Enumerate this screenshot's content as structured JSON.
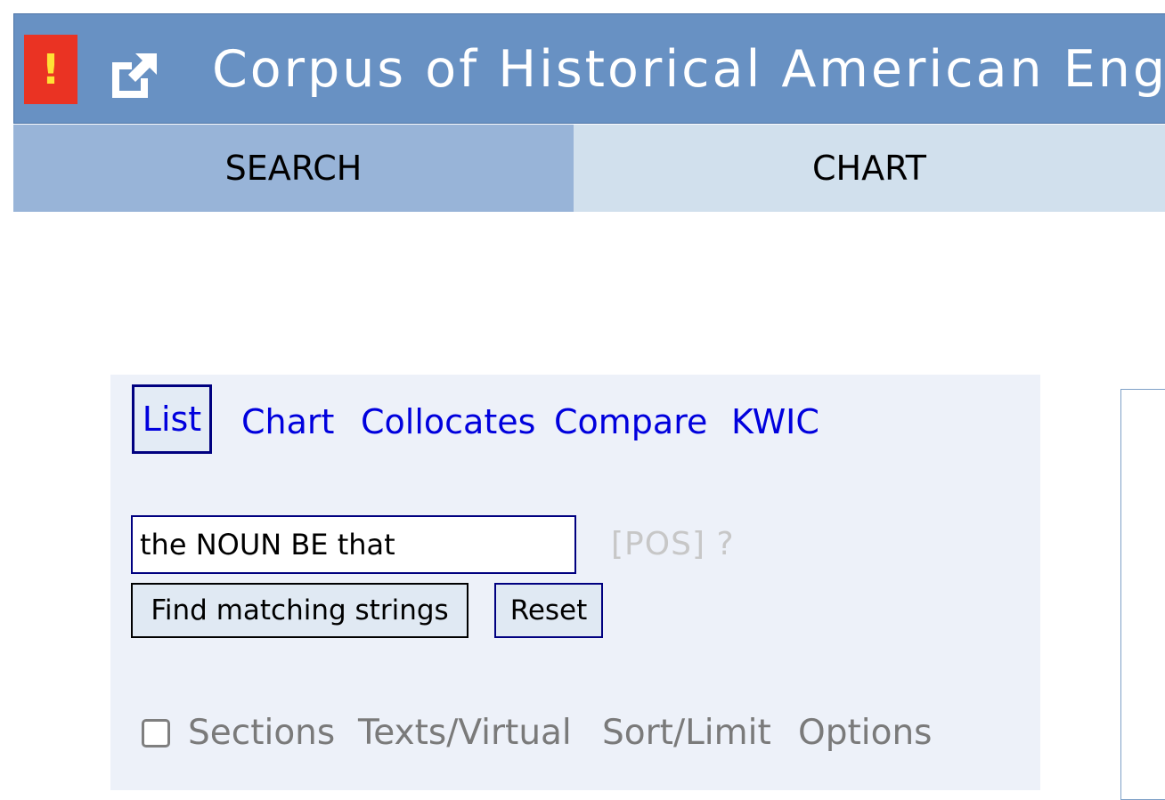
{
  "header": {
    "alert_symbol": "!",
    "alert_color": "#ea3323",
    "title": "Corpus of Historical American English",
    "background_color": "#6891c3",
    "external_link_icon": "external-link-icon"
  },
  "tabs": [
    {
      "label": "SEARCH",
      "active": true
    },
    {
      "label": "CHART",
      "active": false
    }
  ],
  "modes": [
    "List",
    "Chart",
    "Collocates",
    "Compare",
    "KWIC"
  ],
  "active_mode": "List",
  "search": {
    "value": "the NOUN BE that",
    "pos_label": "[POS]",
    "help_label": "?"
  },
  "buttons": {
    "find": "Find matching strings",
    "reset": "Reset"
  },
  "options": {
    "sections_checked": false,
    "sections": "Sections",
    "texts_virtual": "Texts/Virtual",
    "sort_limit": "Sort/Limit",
    "options": "Options"
  }
}
